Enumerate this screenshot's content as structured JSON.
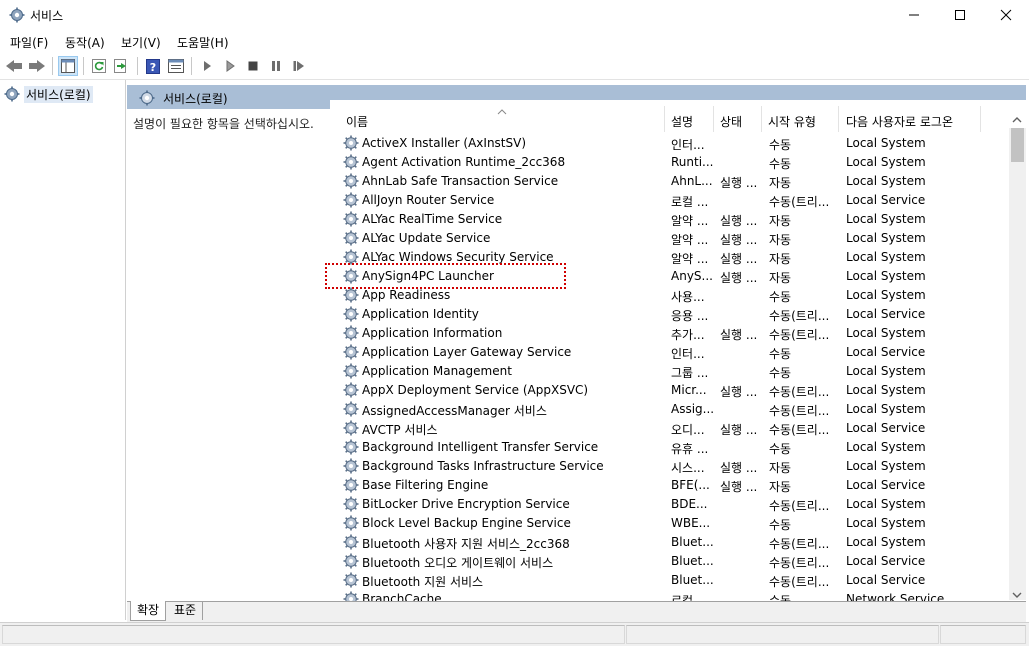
{
  "window": {
    "title": "서비스"
  },
  "menu": [
    "파일(F)",
    "동작(A)",
    "보기(V)",
    "도움말(H)"
  ],
  "tree": {
    "root_label": "서비스(로컬)"
  },
  "pane": {
    "title": "서비스(로컬)",
    "description": "설명이 필요한 항목을 선택하십시오."
  },
  "columns": {
    "name": "이름",
    "description": "설명",
    "status": "상태",
    "startup": "시작 유형",
    "logon": "다음 사용자로 로그온"
  },
  "services": [
    {
      "name": "ActiveX Installer (AxInstSV)",
      "desc": "인터...",
      "status": "",
      "startup": "수동",
      "logon": "Local System"
    },
    {
      "name": "Agent Activation Runtime_2cc368",
      "desc": "Runti...",
      "status": "",
      "startup": "수동",
      "logon": "Local System"
    },
    {
      "name": "AhnLab Safe Transaction Service",
      "desc": "AhnL...",
      "status": "실행 ...",
      "startup": "자동",
      "logon": "Local System"
    },
    {
      "name": "AllJoyn Router Service",
      "desc": "로컬 ...",
      "status": "",
      "startup": "수동(트리...",
      "logon": "Local Service"
    },
    {
      "name": "ALYac RealTime Service",
      "desc": "알약 ...",
      "status": "실행 ...",
      "startup": "자동",
      "logon": "Local System"
    },
    {
      "name": "ALYac Update Service",
      "desc": "알약 ...",
      "status": "실행 ...",
      "startup": "자동",
      "logon": "Local System"
    },
    {
      "name": "ALYac Windows Security Service",
      "desc": "알약 ...",
      "status": "실행 ...",
      "startup": "자동",
      "logon": "Local System"
    },
    {
      "name": "AnySign4PC Launcher",
      "desc": "AnyS...",
      "status": "실행 ...",
      "startup": "자동",
      "logon": "Local System"
    },
    {
      "name": "App Readiness",
      "desc": "사용...",
      "status": "",
      "startup": "수동",
      "logon": "Local System"
    },
    {
      "name": "Application Identity",
      "desc": "응용 ...",
      "status": "",
      "startup": "수동(트리...",
      "logon": "Local Service"
    },
    {
      "name": "Application Information",
      "desc": "추가...",
      "status": "실행 ...",
      "startup": "수동(트리...",
      "logon": "Local System"
    },
    {
      "name": "Application Layer Gateway Service",
      "desc": "인터...",
      "status": "",
      "startup": "수동",
      "logon": "Local Service"
    },
    {
      "name": "Application Management",
      "desc": "그룹 ...",
      "status": "",
      "startup": "수동",
      "logon": "Local System"
    },
    {
      "name": "AppX Deployment Service (AppXSVC)",
      "desc": "Micr...",
      "status": "실행 ...",
      "startup": "수동(트리...",
      "logon": "Local System"
    },
    {
      "name": "AssignedAccessManager 서비스",
      "desc": "Assig...",
      "status": "",
      "startup": "수동(트리...",
      "logon": "Local System"
    },
    {
      "name": "AVCTP 서비스",
      "desc": "오디...",
      "status": "실행 ...",
      "startup": "수동(트리...",
      "logon": "Local Service"
    },
    {
      "name": "Background Intelligent Transfer Service",
      "desc": "유휴 ...",
      "status": "",
      "startup": "수동",
      "logon": "Local System"
    },
    {
      "name": "Background Tasks Infrastructure Service",
      "desc": "시스...",
      "status": "실행 ...",
      "startup": "자동",
      "logon": "Local System"
    },
    {
      "name": "Base Filtering Engine",
      "desc": "BFE(...",
      "status": "실행 ...",
      "startup": "자동",
      "logon": "Local Service"
    },
    {
      "name": "BitLocker Drive Encryption Service",
      "desc": "BDE...",
      "status": "",
      "startup": "수동(트리...",
      "logon": "Local System"
    },
    {
      "name": "Block Level Backup Engine Service",
      "desc": "WBE...",
      "status": "",
      "startup": "수동",
      "logon": "Local System"
    },
    {
      "name": "Bluetooth 사용자 지원 서비스_2cc368",
      "desc": "Bluet...",
      "status": "",
      "startup": "수동(트리...",
      "logon": "Local System"
    },
    {
      "name": "Bluetooth 오디오 게이트웨이 서비스",
      "desc": "Bluet...",
      "status": "",
      "startup": "수동(트리...",
      "logon": "Local Service"
    },
    {
      "name": "Bluetooth 지원 서비스",
      "desc": "Bluet...",
      "status": "",
      "startup": "수동(트리...",
      "logon": "Local Service"
    },
    {
      "name": "BranchCache",
      "desc": "로컬 ...",
      "status": "",
      "startup": "수동",
      "logon": "Network Service"
    }
  ],
  "tabs": [
    "확장",
    "표준"
  ],
  "colors": {
    "pane_header": "#a9bed6",
    "highlight": "#d00000",
    "tree_selected": "#dfe9f5"
  }
}
